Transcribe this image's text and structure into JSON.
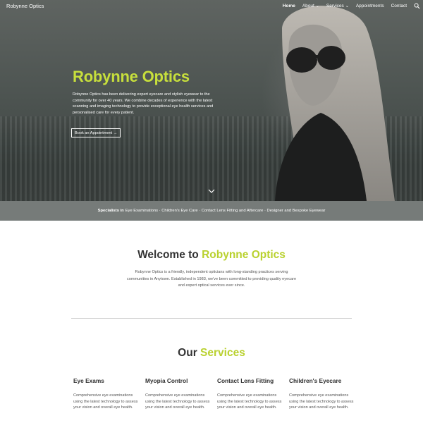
{
  "header": {
    "site_title": "Robynne Optics",
    "nav": [
      {
        "label": "Home",
        "active": true,
        "dropdown": false
      },
      {
        "label": "About",
        "active": false,
        "dropdown": true
      },
      {
        "label": "Services",
        "active": false,
        "dropdown": true
      },
      {
        "label": "Appointments",
        "active": false,
        "dropdown": false
      },
      {
        "label": "Contact",
        "active": false,
        "dropdown": false
      }
    ],
    "search_icon": "search-icon"
  },
  "hero": {
    "title": "Robynne Optics",
    "text": "Robynne Optics has been delivering expert eyecare and stylish eyewear to the community for over 40 years. We combine decades of experience with the latest scanning and imaging technology to provide exceptional eye health services and personalised care for every patient.",
    "button": "Book an Appointment →",
    "scroll_icon": "chevron-down-icon"
  },
  "strip": {
    "lead": "Specialists in",
    "text": "Eye Examinations · Children's Eye Care · Contact Lens Fitting and Aftercare · Designer and Bespoke Eyewear"
  },
  "welcome": {
    "title_plain": "Welcome to",
    "title_accent": "Robynne Optics",
    "text": "Robynne Optics is a friendly, independent opticians with long-standing practices serving communities in Anytown. Established in 1983, we've been committed to providing quality eyecare and expert optical services ever since."
  },
  "services": {
    "title_plain": "Our",
    "title_accent": "Services",
    "items": [
      {
        "title": "Eye Exams",
        "text": "Comprehensive eye examinations using the latest technology to assess your vision and overall eye health."
      },
      {
        "title": "Myopia Control",
        "text": "Comprehensive eye examinations using the latest technology to assess your vision and overall eye health."
      },
      {
        "title": "Contact Lens Fitting",
        "text": "Comprehensive eye examinations using the latest technology to assess your vision and overall eye health."
      },
      {
        "title": "Children's Eyecare",
        "text": "Comprehensive eye examinations using the latest technology to assess your vision and overall eye health."
      }
    ]
  },
  "colors": {
    "accent": "#c7df3c",
    "strip_bg": "#767b79",
    "hero_overlay": "#4e5552"
  }
}
